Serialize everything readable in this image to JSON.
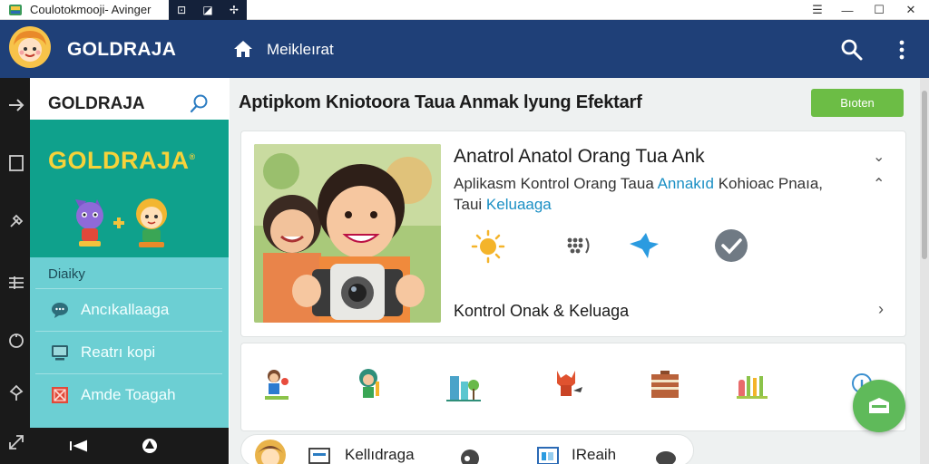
{
  "window": {
    "title": "Coulotokmooji- Avinger",
    "toolbar_glyphs": [
      "⊡",
      "◪",
      "✢"
    ],
    "controls": {
      "minimize": "☰",
      "restore": "—",
      "maximize": "☐",
      "close": "✕"
    }
  },
  "header": {
    "brand": "GOLDRAJA",
    "home_label": "Meikleırat",
    "icons": [
      "logo-avatar",
      "home-icon",
      "search-icon",
      "more-vert-icon"
    ]
  },
  "drawer": {
    "title": "GOLDRAJA",
    "banner_logo": "GOLDRAJA",
    "banner_logo_mark": "®",
    "section_label": "Diaiky",
    "items": [
      {
        "label": "Ancıkallaaga",
        "icon": "chat-icon"
      },
      {
        "label": "Reatrı kopi",
        "icon": "monitor-icon"
      },
      {
        "label": "Amde Toagah",
        "icon": "flag-icon"
      }
    ]
  },
  "main": {
    "heading": "Aptipkom Kniotoora Taua Anmak lyung Efektarf",
    "action_button": "Bıoten",
    "card": {
      "title": "Anatrol Anatol Orang Tua Ank",
      "desc_part1": "Aplikasm Kontrol Orang Taua ",
      "desc_highlight1": "Annakıd",
      "desc_part2": " Kohioac Pnaıa,",
      "desc_part3": "Taui ",
      "desc_highlight2": "Keluaaga",
      "footer": "Kontrol Onak & Keluaga",
      "feature_icons": [
        "sun-icon",
        "dots-icon",
        "bird-icon",
        "check-icon"
      ]
    },
    "strip_icons": [
      "kid-flower-icon",
      "kid-green-icon",
      "city-icon",
      "fox-icon",
      "chest-icon",
      "paint-icon",
      "info-icon"
    ],
    "bottom_bar": {
      "label1": "Kellıdraga",
      "label2": "IReaih"
    }
  },
  "colors": {
    "header": "#1f4078",
    "drawer_teal": "#0fa18c",
    "drawer_light": "#6ccfd3",
    "accent_green": "#6cbd45",
    "highlight_blue": "#1a8fc4"
  }
}
